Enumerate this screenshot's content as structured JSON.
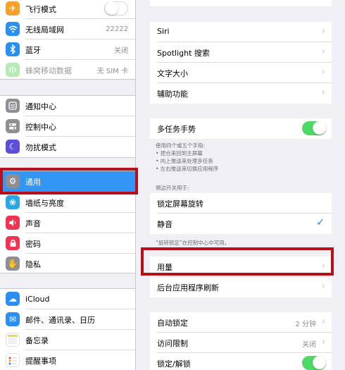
{
  "sidebar": {
    "group1": [
      {
        "label": "飞行模式",
        "value": "",
        "icon": "airplane-icon",
        "color": "#f7a02c"
      },
      {
        "label": "无线局域网",
        "value": "22222",
        "icon": "wifi-icon",
        "color": "#2b8ef1"
      },
      {
        "label": "蓝牙",
        "value": "关闭",
        "icon": "bluetooth-icon",
        "color": "#2b8ef1"
      },
      {
        "label": "蜂窝移动数据",
        "value": "无 SIM 卡",
        "icon": "cellular-icon",
        "color": "#5fd35f"
      }
    ],
    "group2": [
      {
        "label": "通知中心",
        "icon": "notification-center-icon",
        "color": "#8e8e93"
      },
      {
        "label": "控制中心",
        "icon": "control-center-icon",
        "color": "#8e8e93"
      },
      {
        "label": "勿扰模式",
        "icon": "moon-icon",
        "color": "#5d4fd9"
      }
    ],
    "group3": [
      {
        "label": "通用",
        "icon": "gear-icon",
        "color": "#8e8e93"
      },
      {
        "label": "墙纸与亮度",
        "icon": "wallpaper-icon",
        "color": "#2aa6e6"
      },
      {
        "label": "声音",
        "icon": "speaker-icon",
        "color": "#f0334f"
      },
      {
        "label": "密码",
        "icon": "lock-icon",
        "color": "#f0334f"
      },
      {
        "label": "隐私",
        "icon": "hand-icon",
        "color": "#8e8e93"
      }
    ],
    "group4": [
      {
        "label": "iCloud",
        "icon": "cloud-icon",
        "color": "#2b8ef1"
      },
      {
        "label": "邮件、通讯录、日历",
        "icon": "mail-icon",
        "color": "#2b8ef1"
      },
      {
        "label": "备忘录",
        "icon": "notes-icon",
        "color": "#f7d34c"
      },
      {
        "label": "提醒事项",
        "icon": "reminders-icon",
        "color": "#ffffff"
      }
    ]
  },
  "main": {
    "group_a": [
      "Siri",
      "Spotlight 搜索",
      "文字大小",
      "辅助功能"
    ],
    "multitask": {
      "label": "多任务手势",
      "note_lines": [
        "使用四个或五个手指:",
        "• 捏合来回到主屏幕",
        "• 向上推送来处理多任务",
        "• 左右推送来切换应用程序"
      ]
    },
    "side_switch_header": "侧边开关用于:",
    "side_switch": {
      "lock_rotation": "锁定屏幕旋转",
      "mute": "静音",
      "check": "✓"
    },
    "rotation_note": "“旋转锁定”在控制中心中可用。",
    "group_c": [
      "用量",
      "后台应用程序刷新"
    ],
    "group_d": {
      "auto_lock": {
        "label": "自动锁定",
        "value": "2 分钟"
      },
      "restrictions": {
        "label": "访问限制",
        "value": "关闭"
      },
      "lock_unlock": {
        "label": "锁定/解锁"
      }
    },
    "chevron": "›"
  },
  "toggles": {
    "airplane": false,
    "multitask": true,
    "lock_unlock": true
  },
  "highlight_color": "#b5101b",
  "selection_color": "#3395f5"
}
